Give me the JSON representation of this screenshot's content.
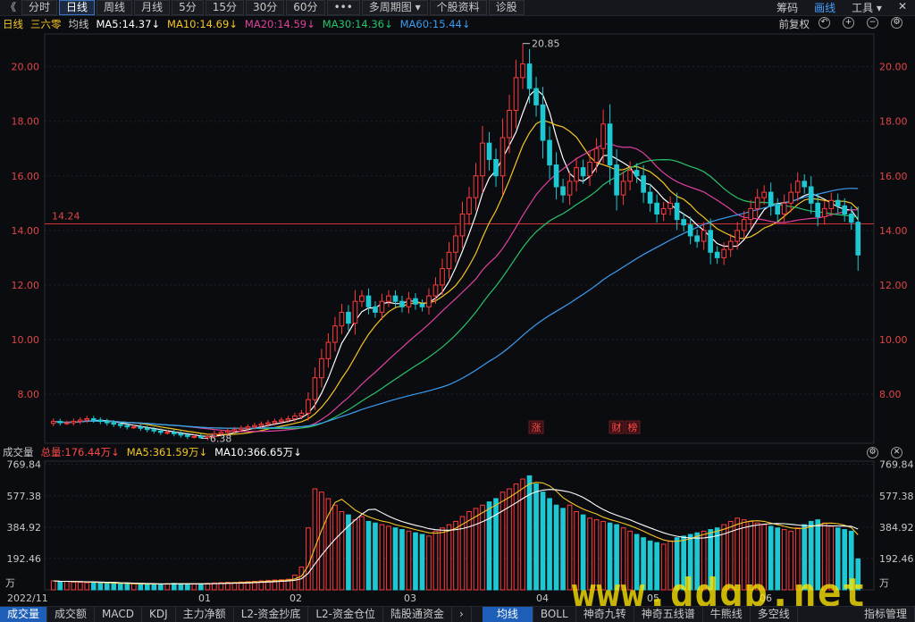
{
  "toolbar": {
    "back_glyph": "《",
    "tabs": [
      "分时",
      "日线",
      "周线",
      "月线",
      "5分",
      "15分",
      "30分",
      "60分",
      "•••",
      "多周期图 ▾",
      "个股资料",
      "诊股"
    ],
    "active_tab": "日线",
    "right": [
      "筹码",
      "画线",
      "工具 ▾"
    ],
    "right_active": "画线",
    "close_glyph": "✕"
  },
  "ma_bar": {
    "period": "日线",
    "name": "三六零",
    "label": "均线",
    "items": [
      {
        "text": "MA5:14.37↓",
        "color": "#ffffff"
      },
      {
        "text": "MA10:14.69↓",
        "color": "#f6c624"
      },
      {
        "text": "MA20:14.59↓",
        "color": "#e0409e"
      },
      {
        "text": "MA30:14.36↓",
        "color": "#27c46a"
      },
      {
        "text": "MA60:15.44↓",
        "color": "#3c9cf0"
      }
    ],
    "right_label": "前复权"
  },
  "vol_bar": {
    "label": "成交量",
    "items": [
      {
        "text": "总量:176.44万↓",
        "color": "#ff4848"
      },
      {
        "text": "MA5:361.59万↓",
        "color": "#f6c624"
      },
      {
        "text": "MA10:366.65万↓",
        "color": "#ffffff"
      }
    ]
  },
  "bottom_tabs": [
    "成交量",
    "成交额",
    "MACD",
    "KDJ",
    "主力净额",
    "L2-资金抄底",
    "L2-资金仓位",
    "陆股通资金",
    "›",
    "均线",
    "BOLL",
    "神奇九转",
    "神奇五线谱",
    "牛熊线",
    "多空线",
    "指标管理"
  ],
  "bottom_active": [
    "成交量",
    "均线"
  ],
  "watermark": "www.ddgp.net",
  "colors": {
    "up": "#ff3b3b",
    "down": "#1ec8d2",
    "ma5": "#ffffff",
    "ma10": "#f6c624",
    "ma20": "#e0409e",
    "ma30": "#27c46a",
    "ma60": "#3c9cf0",
    "refline": "#d23434"
  },
  "chart_data": {
    "type": "candlestick",
    "x_labels": [
      "2022/11",
      "01",
      "02",
      "03",
      "04",
      "05",
      "06"
    ],
    "price_axis": {
      "ticks": [
        "20.00",
        "18.00",
        "16.00",
        "14.00",
        "12.00",
        "10.00",
        "8.00"
      ],
      "ylim": [
        6.2,
        21.2
      ]
    },
    "reference_line": {
      "value": 14.24,
      "label": "14.24"
    },
    "annotations": {
      "high": "20.85",
      "low": "6.38",
      "events": [
        "涨",
        "财",
        "榜"
      ]
    },
    "close_path": [
      7.0,
      6.95,
      6.95,
      7.0,
      7.05,
      7.1,
      7.05,
      7.0,
      6.95,
      6.9,
      6.85,
      6.8,
      6.8,
      6.75,
      6.7,
      6.65,
      6.6,
      6.6,
      6.55,
      6.5,
      6.45,
      6.45,
      6.4,
      6.45,
      6.55,
      6.6,
      6.65,
      6.7,
      6.75,
      6.8,
      6.85,
      6.9,
      6.95,
      7.0,
      7.05,
      7.1,
      7.2,
      7.3,
      7.8,
      8.6,
      9.3,
      9.9,
      10.5,
      11.0,
      10.6,
      11.4,
      11.6,
      11.2,
      11.0,
      11.4,
      11.6,
      11.4,
      11.2,
      11.5,
      11.3,
      11.2,
      11.6,
      12.0,
      12.6,
      13.2,
      13.8,
      14.6,
      15.2,
      16.0,
      17.2,
      16.6,
      16.0,
      17.4,
      18.4,
      19.6,
      20.1,
      19.2,
      18.6,
      17.3,
      16.4,
      15.6,
      15.3,
      15.8,
      16.3,
      16.0,
      16.5,
      17.0,
      17.9,
      16.4,
      15.3,
      15.8,
      16.2,
      16.0,
      15.4,
      15.0,
      14.6,
      14.8,
      15.0,
      14.4,
      14.2,
      13.8,
      13.6,
      14.0,
      13.2,
      13.0,
      13.3,
      13.6,
      14.0,
      14.4,
      14.8,
      15.2,
      15.4,
      14.9,
      14.6,
      15.0,
      15.4,
      15.8,
      15.6,
      15.0,
      14.5,
      14.8,
      15.1,
      14.9,
      14.6,
      14.3,
      13.1
    ],
    "volume_axis": {
      "ticks": [
        "769.84",
        "577.38",
        "384.92",
        "192.46"
      ],
      "unit": "万",
      "ylim": [
        0,
        790
      ]
    },
    "volume_path": [
      55,
      50,
      52,
      48,
      46,
      44,
      45,
      42,
      40,
      38,
      36,
      35,
      38,
      36,
      35,
      34,
      36,
      38,
      40,
      38,
      36,
      35,
      38,
      40,
      42,
      44,
      46,
      45,
      48,
      50,
      52,
      55,
      58,
      60,
      62,
      65,
      90,
      140,
      380,
      620,
      600,
      560,
      520,
      480,
      460,
      430,
      450,
      420,
      410,
      400,
      390,
      380,
      370,
      360,
      350,
      340,
      330,
      360,
      380,
      400,
      420,
      450,
      480,
      500,
      520,
      540,
      560,
      600,
      620,
      650,
      680,
      700,
      650,
      600,
      560,
      520,
      500,
      520,
      480,
      460,
      440,
      430,
      420,
      410,
      400,
      380,
      360,
      340,
      320,
      300,
      290,
      280,
      300,
      320,
      330,
      340,
      350,
      360,
      370,
      380,
      400,
      420,
      440,
      430,
      420,
      410,
      400,
      390,
      380,
      370,
      360,
      380,
      400,
      420,
      430,
      410,
      390,
      380,
      370,
      360,
      190
    ]
  }
}
